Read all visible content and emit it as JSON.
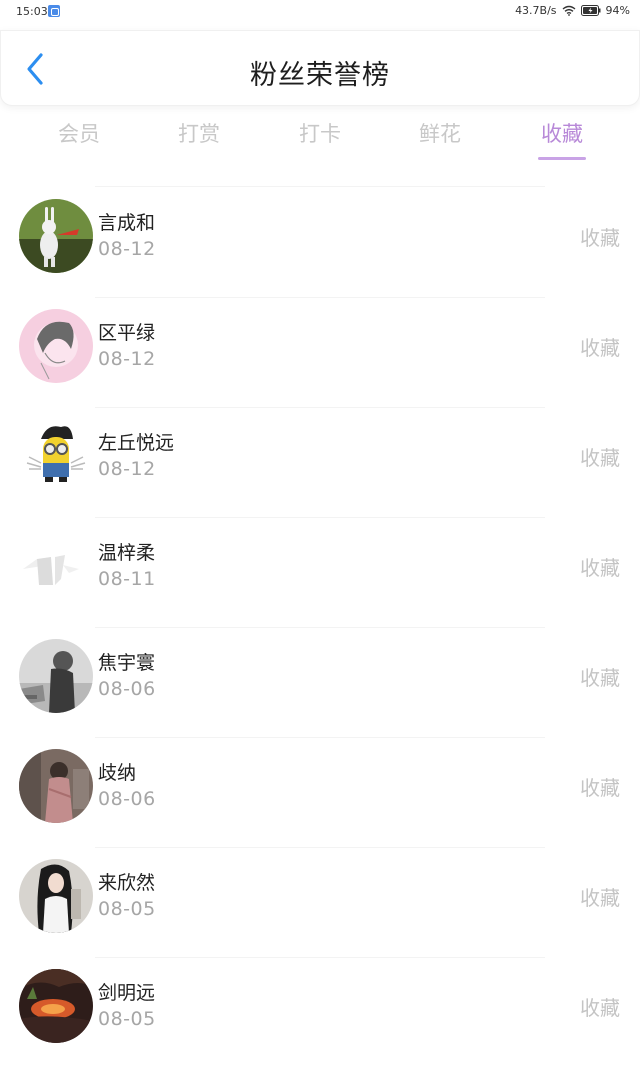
{
  "status_bar": {
    "time": "15:03",
    "network_speed": "43.7B/s",
    "battery": "94%"
  },
  "header": {
    "title": "粉丝荣誉榜"
  },
  "tabs": [
    {
      "label": "会员",
      "active": false
    },
    {
      "label": "打赏",
      "active": false
    },
    {
      "label": "打卡",
      "active": false
    },
    {
      "label": "鲜花",
      "active": false
    },
    {
      "label": "收藏",
      "active": true
    }
  ],
  "colors": {
    "accent": "#b889d8",
    "back_icon": "#2c8ef0",
    "muted": "#c4c4c4"
  },
  "fans": [
    {
      "name": "言成和",
      "date": "08-12",
      "action": "收藏",
      "avatar": "white-rabbit-toy"
    },
    {
      "name": "区平绿",
      "date": "08-12",
      "action": "收藏",
      "avatar": "sketch-girl-pink"
    },
    {
      "name": "左丘悦远",
      "date": "08-12",
      "action": "收藏",
      "avatar": "minion-wolverine"
    },
    {
      "name": "温梓柔",
      "date": "08-11",
      "action": "收藏",
      "avatar": "white-abstract"
    },
    {
      "name": "焦宇寰",
      "date": "08-06",
      "action": "收藏",
      "avatar": "grey-silhouette"
    },
    {
      "name": "歧纳",
      "date": "08-06",
      "action": "收藏",
      "avatar": "girl-in-room"
    },
    {
      "name": "来欣然",
      "date": "08-05",
      "action": "收藏",
      "avatar": "girl-portrait"
    },
    {
      "name": "剑明远",
      "date": "08-05",
      "action": "收藏",
      "avatar": "sunset-landscape"
    }
  ]
}
